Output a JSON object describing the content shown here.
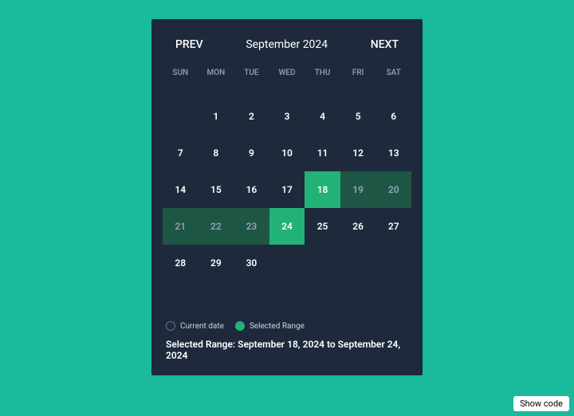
{
  "header": {
    "prev_label": "PREV",
    "next_label": "NEXT",
    "month_title": "September 2024"
  },
  "weekdays": [
    "SUN",
    "MON",
    "TUE",
    "WED",
    "THU",
    "FRI",
    "SAT"
  ],
  "days": [
    {
      "num": "",
      "state": "empty"
    },
    {
      "num": "1",
      "state": "normal"
    },
    {
      "num": "2",
      "state": "normal"
    },
    {
      "num": "3",
      "state": "normal"
    },
    {
      "num": "4",
      "state": "normal"
    },
    {
      "num": "5",
      "state": "normal"
    },
    {
      "num": "6",
      "state": "normal"
    },
    {
      "num": "7",
      "state": "normal"
    },
    {
      "num": "8",
      "state": "normal"
    },
    {
      "num": "9",
      "state": "normal"
    },
    {
      "num": "10",
      "state": "normal"
    },
    {
      "num": "11",
      "state": "normal"
    },
    {
      "num": "12",
      "state": "normal"
    },
    {
      "num": "13",
      "state": "normal"
    },
    {
      "num": "14",
      "state": "normal"
    },
    {
      "num": "15",
      "state": "normal"
    },
    {
      "num": "16",
      "state": "normal"
    },
    {
      "num": "17",
      "state": "normal"
    },
    {
      "num": "18",
      "state": "range-end"
    },
    {
      "num": "19",
      "state": "in-range"
    },
    {
      "num": "20",
      "state": "in-range"
    },
    {
      "num": "21",
      "state": "in-range"
    },
    {
      "num": "22",
      "state": "in-range"
    },
    {
      "num": "23",
      "state": "in-range"
    },
    {
      "num": "24",
      "state": "range-end"
    },
    {
      "num": "25",
      "state": "normal"
    },
    {
      "num": "26",
      "state": "normal"
    },
    {
      "num": "27",
      "state": "normal"
    },
    {
      "num": "28",
      "state": "normal"
    },
    {
      "num": "29",
      "state": "normal"
    },
    {
      "num": "30",
      "state": "normal"
    }
  ],
  "legend": {
    "current_label": "Current date",
    "selected_label": "Selected Range"
  },
  "range_text": "Selected Range: September 18, 2024 to September 24, 2024",
  "show_code_label": "Show code"
}
